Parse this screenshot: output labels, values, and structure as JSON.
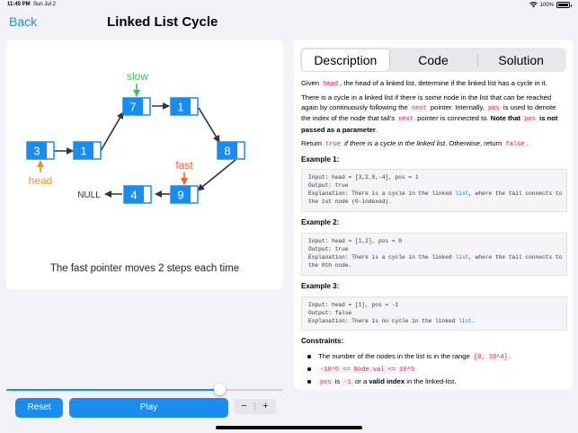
{
  "status_bar": {
    "time": "11:45 PM",
    "date": "Sun Jul 2",
    "battery": "100%"
  },
  "nav": {
    "back_label": "Back",
    "title": "Linked List Cycle"
  },
  "visualization": {
    "nodes": [
      "3",
      "1",
      "7",
      "1",
      "8",
      "9",
      "4"
    ],
    "null_label": "NULL",
    "labels": {
      "head": "head",
      "slow": "slow",
      "fast": "fast"
    },
    "caption": "The fast pointer moves 2 steps each time",
    "colors": {
      "node": "#1a8cf0",
      "slow": "#34c759",
      "fast": "#ff5a1f",
      "head": "#ff8c1a"
    }
  },
  "tabs": [
    {
      "label": "Description",
      "active": true
    },
    {
      "label": "Code",
      "active": false
    },
    {
      "label": "Solution",
      "active": false
    }
  ],
  "description": {
    "p1": {
      "t1": "Given ",
      "c1": "head",
      "t2": ", the head of a linked list, determine if the linked list has a cycle in it."
    },
    "p2": {
      "t1": "There is a cycle in a linked list if there is some node in the list that can be reached again by continuously following the ",
      "c1": "next",
      "t2": " pointer. Internally, ",
      "c2": "pos",
      "t3": " is used to denote the index of the node that tail's ",
      "c3": "next",
      "t4": " pointer is connected to. ",
      "b1": "Note that ",
      "c4": "pos",
      "b2": " is not passed as a parameter",
      "t5": "."
    },
    "p3": {
      "t1": "Return ",
      "c1": "true",
      "i1": " if there is a cycle in the linked list",
      "t2": ". Otherwise, return ",
      "c2": "false",
      "t3": "."
    },
    "examples": [
      {
        "title": "Example 1:",
        "input": "Input: head = [3,2,0,-4], pos = 1",
        "output": "Output: true",
        "exp_pre": "Explanation: There is a cycle in the linked ",
        "exp_hl": "list",
        "exp_post": ", where the tail connects to\nthe 1st node (0-indexed)."
      },
      {
        "title": "Example 2:",
        "input": "Input: head = [1,2], pos = 0",
        "output": "Output: true",
        "exp_pre": "Explanation: There is a cycle in the linked ",
        "exp_hl": "list",
        "exp_post": ", where the tail connects to\nthe 0th node."
      },
      {
        "title": "Example 3:",
        "input": "Input: head = [1], pos = -1",
        "output": "Output: false",
        "exp_pre": "Explanation: There is no cycle in the linked ",
        "exp_hl": "list",
        "exp_post": "."
      }
    ],
    "constraints_title": "Constraints:",
    "constraints": {
      "c1_pre": "The number of the nodes in the list is in the range ",
      "c1_code": "[0, 10^4]",
      "c1_post": ".",
      "c2_code": "-10^5 <= Node.val <= 10^5",
      "c3_code": "pos",
      "c3_mid": " is ",
      "c3_code2": "-1",
      "c3_or": " or a ",
      "c3_bold": "valid index",
      "c3_post": " in the linked-list."
    }
  },
  "controls": {
    "reset_label": "Reset",
    "play_label": "Play",
    "minus_label": "−",
    "plus_label": "+",
    "progress": 0.77
  }
}
